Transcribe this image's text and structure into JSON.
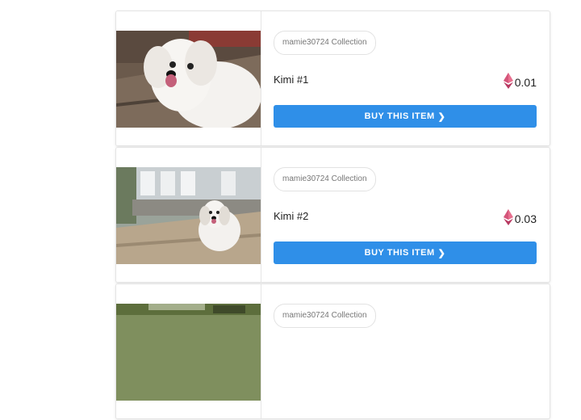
{
  "items": [
    {
      "collection": "mamie30724 Collection",
      "name": "Kimi #1",
      "price": "0.01",
      "buy_label": "BUY THIS ITEM",
      "buy_icon": "chevron-right-icon",
      "currency_icon": "ethereum-icon"
    },
    {
      "collection": "mamie30724 Collection",
      "name": "Kimi #2",
      "price": "0.03",
      "buy_label": "BUY THIS ITEM",
      "buy_icon": "chevron-right-icon",
      "currency_icon": "ethereum-icon"
    },
    {
      "collection": "mamie30724 Collection"
    }
  ],
  "colors": {
    "button": "#2f8fe8",
    "eth_top": "#e8708f",
    "eth_bottom": "#b83a62"
  }
}
